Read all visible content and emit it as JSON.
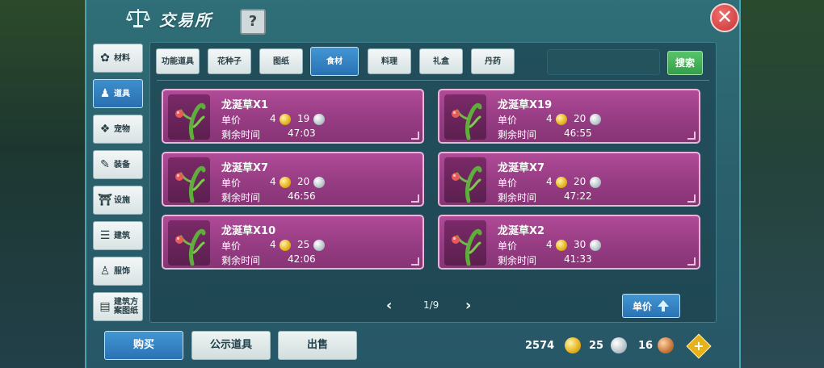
{
  "window": {
    "title": "交易所",
    "help_label": "?",
    "close_label": "✕"
  },
  "sidebar": {
    "items": [
      {
        "label": "材料",
        "icon": "materials-icon"
      },
      {
        "label": "道具",
        "icon": "item-icon",
        "active": true
      },
      {
        "label": "宠物",
        "icon": "paw-icon"
      },
      {
        "label": "装备",
        "icon": "equipment-icon"
      },
      {
        "label": "设施",
        "icon": "facility-icon"
      },
      {
        "label": "建筑",
        "icon": "building-icon"
      },
      {
        "label": "服饰",
        "icon": "clothing-icon"
      },
      {
        "label": "建筑方案图纸",
        "icon": "blueprint-icon"
      }
    ]
  },
  "tabs": [
    {
      "label": "功能道具"
    },
    {
      "label": "花种子"
    },
    {
      "label": "图纸"
    },
    {
      "label": "食材",
      "active": true
    },
    {
      "label": "料理"
    },
    {
      "label": "礼盒"
    },
    {
      "label": "丹药"
    }
  ],
  "search": {
    "value": "",
    "button_label": "搜索"
  },
  "listing_labels": {
    "price": "单价",
    "time": "剩余时间"
  },
  "listings": [
    {
      "name": "龙涎草X1",
      "gold": "4",
      "silver": "19",
      "time": "47:03"
    },
    {
      "name": "龙涎草X19",
      "gold": "4",
      "silver": "20",
      "time": "46:55"
    },
    {
      "name": "龙涎草X7",
      "gold": "4",
      "silver": "20",
      "time": "46:56"
    },
    {
      "name": "龙涎草X7",
      "gold": "4",
      "silver": "20",
      "time": "47:22"
    },
    {
      "name": "龙涎草X10",
      "gold": "4",
      "silver": "25",
      "time": "42:06"
    },
    {
      "name": "龙涎草X2",
      "gold": "4",
      "silver": "30",
      "time": "41:33"
    }
  ],
  "pager": {
    "text": "1/9",
    "prev": "‹",
    "next": "›"
  },
  "sort": {
    "label": "单价",
    "direction": "ascending"
  },
  "bottom": {
    "buy_label": "购买",
    "public_label": "公示道具",
    "sell_label": "出售"
  },
  "currency": {
    "gold": "2574",
    "silver": "25",
    "bronze": "16"
  },
  "colors": {
    "accent_blue": "#2a72b3",
    "card_purple": "#963c83",
    "panel_teal": "#2a5f6b"
  }
}
